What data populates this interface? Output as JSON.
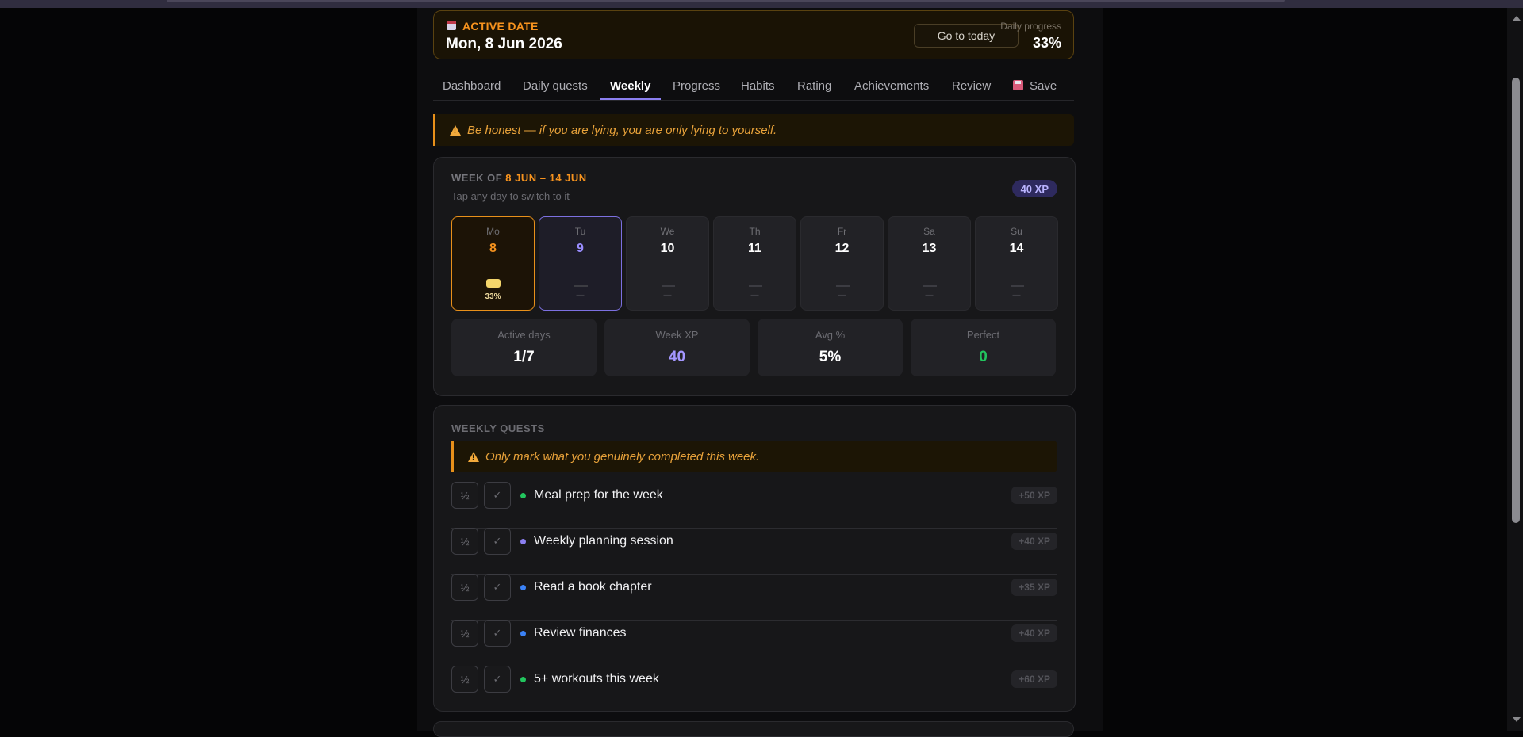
{
  "header": {
    "active_label": "ACTIVE DATE",
    "active_date": "Mon, 8 Jun 2026",
    "today_button": "Go to today",
    "progress_label": "Daily progress",
    "progress_value": "33%"
  },
  "tabs": [
    {
      "label": "Dashboard"
    },
    {
      "label": "Daily quests"
    },
    {
      "label": "Weekly",
      "active": true
    },
    {
      "label": "Progress"
    },
    {
      "label": "Habits"
    },
    {
      "label": "Rating"
    },
    {
      "label": "Achievements"
    },
    {
      "label": "Review"
    },
    {
      "label": "Save",
      "icon": "floppy-disk-icon"
    }
  ],
  "warnings": {
    "top": "Be honest — if you are lying, you are only lying to yourself.",
    "weekly": "Only mark what you genuinely completed this week."
  },
  "week": {
    "prefix": "WEEK OF",
    "range": "8 JUN – 14 JUN",
    "subtitle": "Tap any day to switch to it",
    "xp_badge": "40 XP",
    "days": [
      {
        "name": "Mo",
        "num": "8",
        "pct": "33%",
        "progress": 0.33
      },
      {
        "name": "Tu",
        "num": "9",
        "pct": "—"
      },
      {
        "name": "We",
        "num": "10",
        "pct": "—"
      },
      {
        "name": "Th",
        "num": "11",
        "pct": "—"
      },
      {
        "name": "Fr",
        "num": "12",
        "pct": "—"
      },
      {
        "name": "Sa",
        "num": "13",
        "pct": "—"
      },
      {
        "name": "Su",
        "num": "14",
        "pct": "—"
      }
    ],
    "stats": [
      {
        "label": "Active days",
        "value": "1/7",
        "color": "#ffffff"
      },
      {
        "label": "Week XP",
        "value": "40",
        "color": "#a497ff"
      },
      {
        "label": "Avg %",
        "value": "5%",
        "color": "#ffffff"
      },
      {
        "label": "Perfect",
        "value": "0",
        "color": "#22c55e"
      }
    ]
  },
  "weekly_quests": {
    "title": "WEEKLY QUESTS",
    "half_label": "½",
    "check_label": "✓",
    "items": [
      {
        "name": "Meal prep for the week",
        "xp": "+50 XP",
        "color": "#22c55e"
      },
      {
        "name": "Weekly planning session",
        "xp": "+40 XP",
        "color": "#8b7ff0"
      },
      {
        "name": "Read a book chapter",
        "xp": "+35 XP",
        "color": "#3b82f6"
      },
      {
        "name": "Review finances",
        "xp": "+40 XP",
        "color": "#3b82f6"
      },
      {
        "name": "5+ workouts this week",
        "xp": "+60 XP",
        "color": "#22c55e"
      }
    ]
  },
  "colors": {
    "accent_orange": "#f7931e",
    "accent_purple": "#8b7ff0",
    "background": "#0d0d0f"
  }
}
